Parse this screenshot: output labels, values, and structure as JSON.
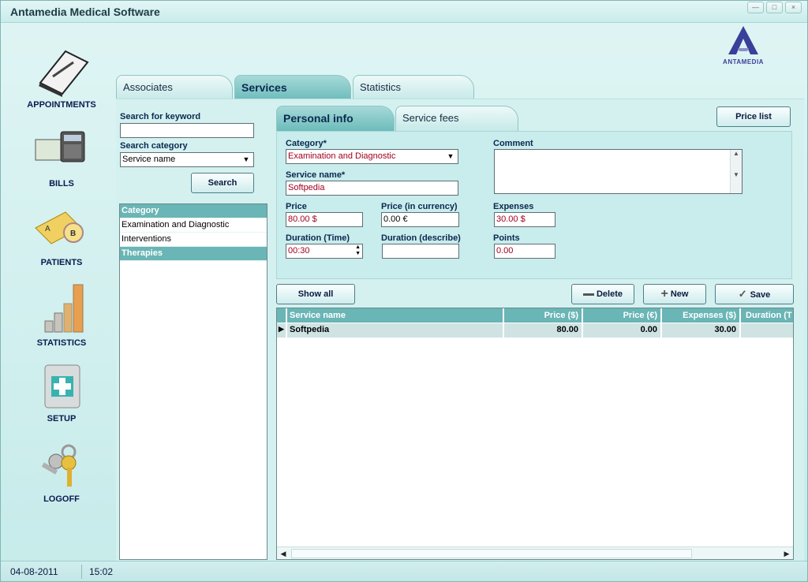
{
  "window": {
    "title": "Antamedia Medical Software",
    "controls": [
      "—",
      "□",
      "×"
    ]
  },
  "logo": {
    "text": "ANTAMEDIA",
    "color": "#3a3f9a"
  },
  "sidebar": {
    "items": [
      {
        "label": "APPOINTMENTS",
        "icon": "clipboard-icon"
      },
      {
        "label": "BILLS",
        "icon": "calculator-icon"
      },
      {
        "label": "PATIENTS",
        "icon": "tabs-icon"
      },
      {
        "label": "STATISTICS",
        "icon": "bar-chart-icon"
      },
      {
        "label": "SETUP",
        "icon": "medkit-icon"
      },
      {
        "label": "LOGOFF",
        "icon": "keys-icon"
      }
    ]
  },
  "main_tabs": [
    {
      "label": "Associates"
    },
    {
      "label": "Services"
    },
    {
      "label": "Statistics"
    }
  ],
  "search": {
    "keyword_label": "Search for keyword",
    "keyword_value": "",
    "category_label": "Search category",
    "category_value": "Service name",
    "search_button": "Search"
  },
  "categories": {
    "header": "Category",
    "items": [
      "Examination and Diagnostic",
      "Interventions"
    ],
    "section": "Therapies"
  },
  "sub_tabs": [
    {
      "label": "Personal info"
    },
    {
      "label": "Service fees"
    }
  ],
  "price_list_button": "Price list",
  "form": {
    "category": {
      "label": "Category*",
      "value": "Examination and Diagnostic"
    },
    "service_name": {
      "label": "Service name*",
      "value": "Softpedia"
    },
    "comment": {
      "label": "Comment",
      "value": ""
    },
    "price": {
      "label": "Price",
      "value": "80.00 $"
    },
    "price_currency": {
      "label": "Price (in currency)",
      "value": "0.00 €"
    },
    "expenses": {
      "label": "Expenses",
      "value": "30.00 $"
    },
    "duration_time": {
      "label": "Duration (Time)",
      "value": "00:30"
    },
    "duration_describe": {
      "label": "Duration (describe)",
      "value": ""
    },
    "points": {
      "label": "Points",
      "value": "0.00"
    }
  },
  "actions": {
    "show_all": "Show all",
    "delete": "Delete",
    "new": "New",
    "save": "Save"
  },
  "grid": {
    "columns": [
      "Service name",
      "Price ($)",
      "Price (€)",
      "Expenses ($)",
      "Duration (T"
    ],
    "rows": [
      {
        "name": "Softpedia",
        "price": "80.00",
        "price_eur": "0.00",
        "expenses": "30.00",
        "duration": ""
      }
    ]
  },
  "status": {
    "date": "04-08-2011",
    "time": "15:02"
  }
}
